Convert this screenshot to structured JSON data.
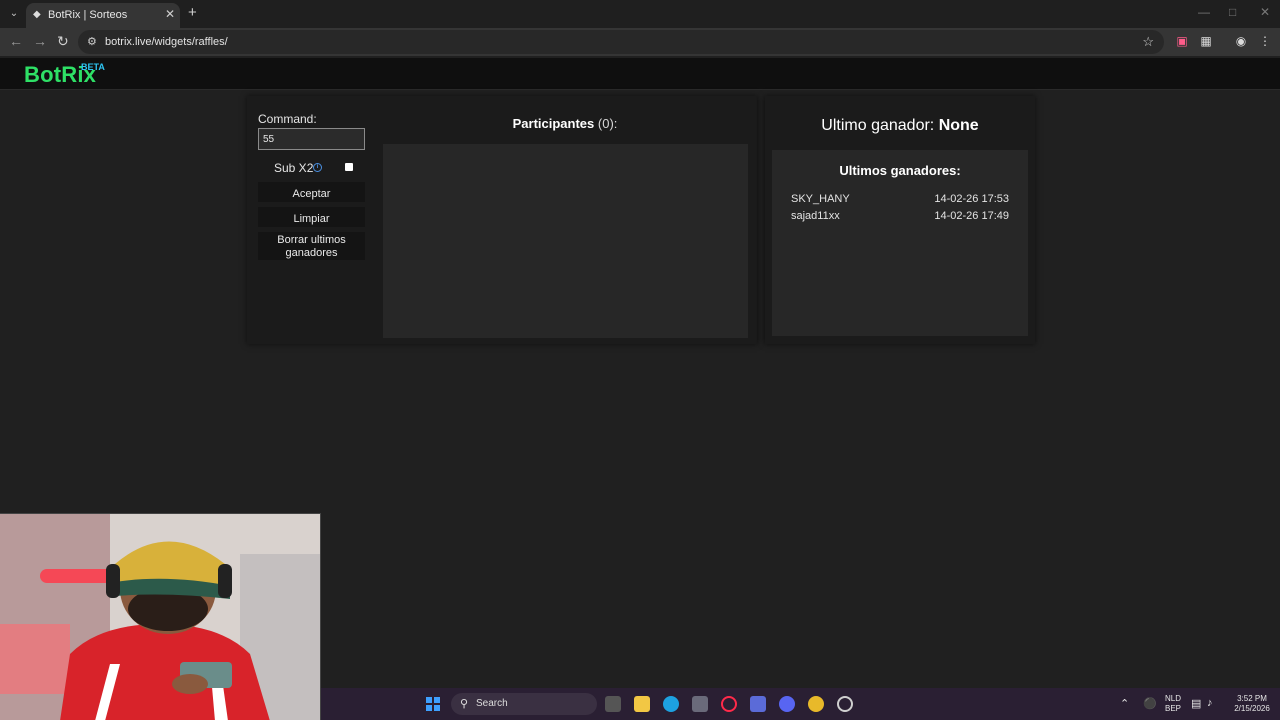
{
  "browser": {
    "tab_title": "BotRix | Sorteos",
    "url": "botrix.live/widgets/raffles/"
  },
  "site": {
    "logo": "BotRix",
    "badge": "BETA",
    "colors": {
      "logo": "#2ee066",
      "badge": "#2ec5f3",
      "info": "#4a90e2"
    }
  },
  "raffle": {
    "command_label": "Command:",
    "command_value": "55",
    "subx2_label": "Sub X2",
    "subx2_checked": false,
    "accept_label": "Aceptar",
    "clear_label": "Limpiar",
    "clear_winners_label": "Borrar ultimos ganadores",
    "participants_label": "Participantes",
    "participants_count": "(0):"
  },
  "winners": {
    "last_winner_label": "Ultimo ganador:",
    "last_winner_value": "None",
    "list_title": "Ultimos ganadores:",
    "items": [
      {
        "name": "SKY_HANY",
        "time": "14-02-26 17:53"
      },
      {
        "name": "sajad11xx",
        "time": "14-02-26 17:49"
      }
    ]
  },
  "taskbar": {
    "search_placeholder": "Search",
    "lang_top": "NLD",
    "lang_bottom": "BEP",
    "time": "3:52 PM",
    "date": "2/15/2026"
  }
}
